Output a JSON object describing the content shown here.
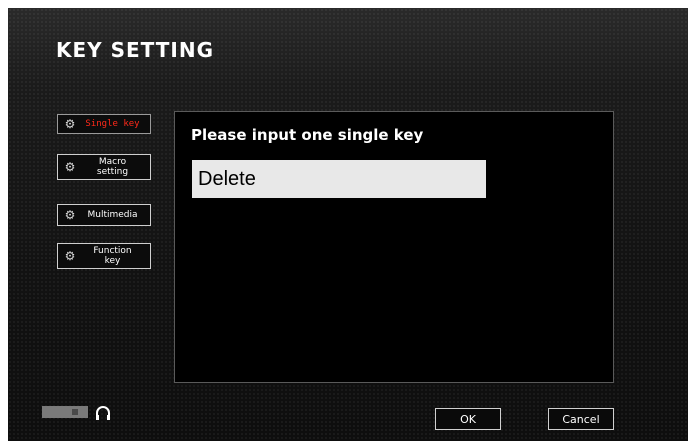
{
  "header": {
    "title": "KEY SETTING"
  },
  "sidebar": {
    "items": [
      {
        "label": "Single key",
        "icon": "gear-icon",
        "active": true
      },
      {
        "label": "Macro\nsetting",
        "icon": "gear-icon",
        "active": false
      },
      {
        "label": "Multimedia",
        "icon": "gear-icon",
        "active": false
      },
      {
        "label": "Function\nkey",
        "icon": "gear-icon",
        "active": false
      }
    ]
  },
  "panel": {
    "prompt": "Please input one single key",
    "key_value": "Delete"
  },
  "footer": {
    "ok_label": "OK",
    "cancel_label": "Cancel",
    "logo_icon": "brand-logo-icon",
    "headset_icon": "headset-icon"
  },
  "colors": {
    "active_label": "#ff2a1a",
    "panel_bg": "#000000",
    "field_bg": "#e8e8e8"
  }
}
